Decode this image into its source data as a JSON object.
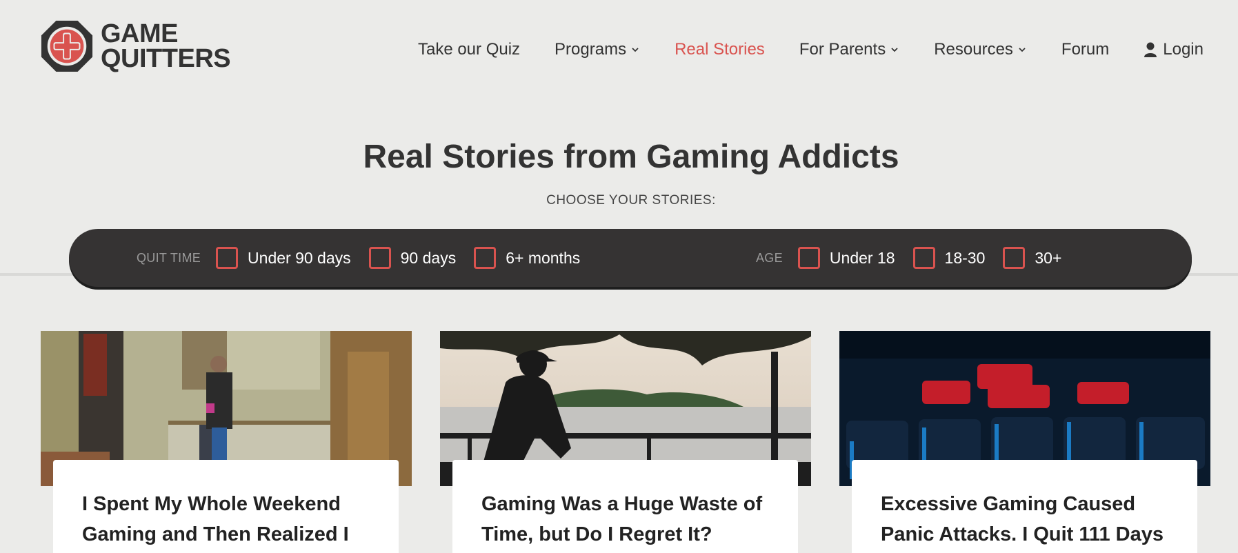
{
  "logo": {
    "line1": "GAME",
    "line2": "QUITTERS"
  },
  "nav": {
    "quiz": "Take our Quiz",
    "programs": "Programs",
    "real_stories": "Real Stories",
    "for_parents": "For Parents",
    "resources": "Resources",
    "forum": "Forum",
    "login": "Login"
  },
  "hero": {
    "title": "Real Stories from Gaming Addicts",
    "subtitle": "CHOOSE YOUR STORIES:"
  },
  "filters": {
    "quit_time": {
      "label": "QUIT TIME",
      "options": [
        "Under 90 days",
        "90 days",
        "6+ months"
      ]
    },
    "age": {
      "label": "AGE",
      "options": [
        "Under 18",
        "18-30",
        "30+"
      ]
    }
  },
  "cards": [
    {
      "title_line1": "I Spent My Whole Weekend",
      "title_line2": "Gaming and Then Realized I"
    },
    {
      "title_line1": "Gaming Was a Huge Waste of",
      "title_line2": "Time, but Do I Regret It?"
    },
    {
      "title_line1": "Excessive Gaming Caused",
      "title_line2": "Panic Attacks. I Quit 111 Days"
    }
  ],
  "colors": {
    "accent": "#d9534f",
    "background": "#ebebe9",
    "filter_bar": "#353333",
    "text": "#333333"
  }
}
